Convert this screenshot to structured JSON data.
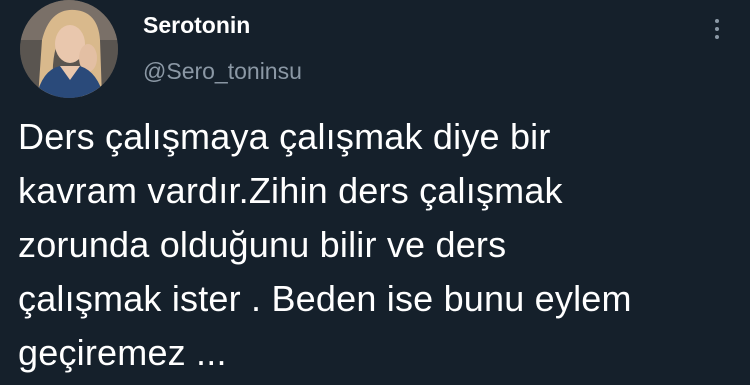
{
  "author": {
    "display_name": "Serotonin",
    "handle": "@Sero_toninsu",
    "avatar_icon": "profile-photo-avatar"
  },
  "actions": {
    "more_icon": "vertical-ellipsis-icon"
  },
  "tweet": {
    "lines": [
      "Ders çalışmaya çalışmak diye bir",
      "kavram vardır.Zihin ders çalışmak",
      "zorunda olduğunu bilir ve ders",
      "çalışmak ister . Beden ise bunu eylem",
      "geçiremez ..."
    ]
  },
  "colors": {
    "background": "#15202b",
    "primary_text": "#ffffff",
    "secondary_text": "#8b98a5"
  }
}
